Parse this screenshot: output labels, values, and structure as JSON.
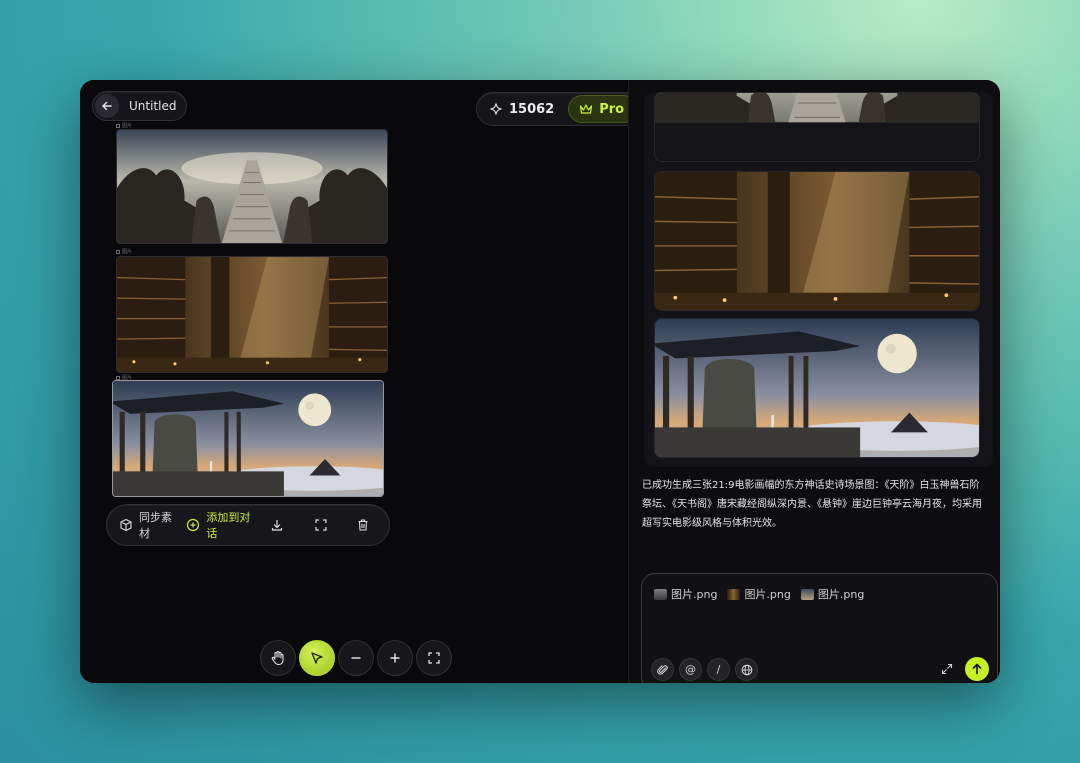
{
  "header": {
    "title": "Untitled",
    "credits": "15062",
    "plan": "Pro"
  },
  "canvas": {
    "image_tag": "图片",
    "images": [
      {
        "label": "图片",
        "name": "天阶",
        "selected": false
      },
      {
        "label": "图片",
        "name": "天书阁",
        "selected": false
      },
      {
        "label": "图片",
        "name": "悬钟",
        "selected": true
      }
    ]
  },
  "toolbar": {
    "sync_label": "同步素材",
    "add_label": "添加到对话",
    "download_icon": "download-icon",
    "fullscreen_icon": "fullscreen-icon",
    "delete_icon": "trash-icon"
  },
  "zoom_controls": [
    "hand-icon",
    "pointer-icon",
    "zoom-out-icon",
    "zoom-in-icon",
    "fit-screen-icon"
  ],
  "chat": {
    "message": "已成功生成三张21:9电影画幅的东方神话史诗场景图：《天阶》白玉神兽石阶祭坛、《天书阁》唐宋藏经阁纵深内景、《悬钟》崖边巨钟亭云海月夜，均采用超写实电影级风格与体积光效。",
    "attachments": [
      "图片.png",
      "图片.png",
      "图片.png"
    ],
    "input_buttons": [
      "attach-icon",
      "@",
      "/",
      "globe-icon"
    ]
  },
  "colors": {
    "accent": "#c8f026",
    "background": "#0a0a0c"
  }
}
